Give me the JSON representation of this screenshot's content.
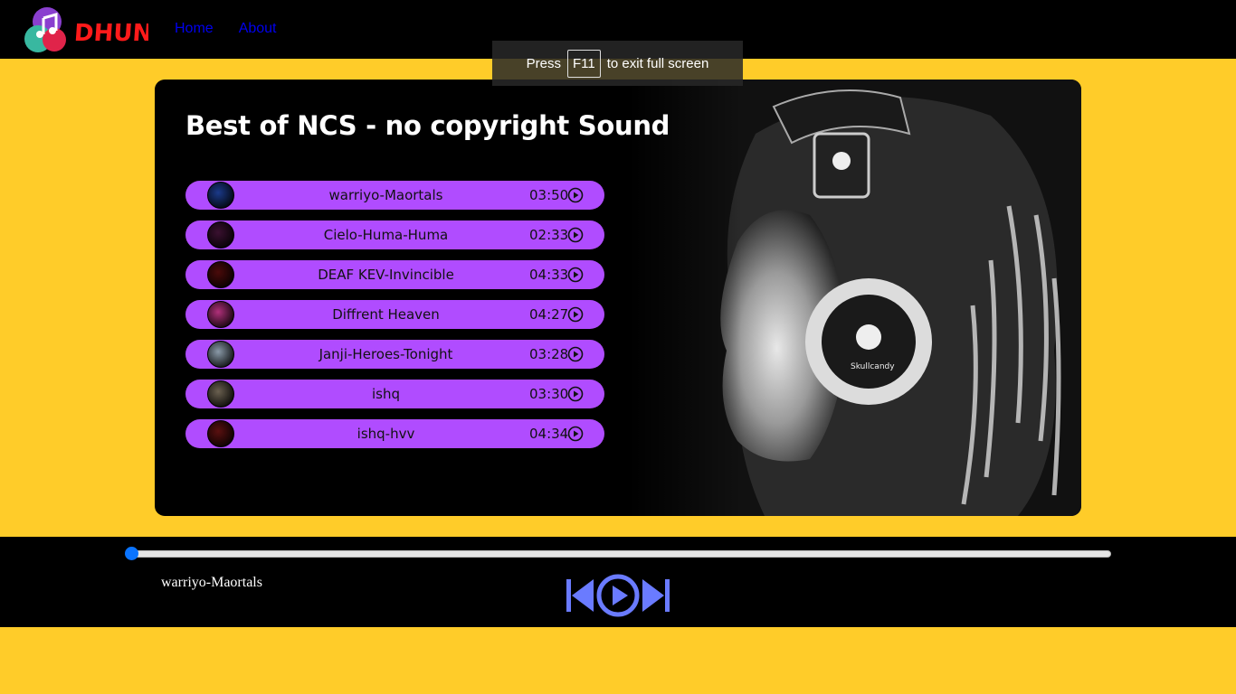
{
  "nav": {
    "brand": "DHUN",
    "links": [
      "Home",
      "About"
    ]
  },
  "toast": {
    "prefix": "Press",
    "key": "F11",
    "suffix": "to exit full screen"
  },
  "playlist": {
    "title": "Best of NCS - no copyright Sound",
    "songs": [
      {
        "name": "warriyo-Maortals",
        "duration": "03:50",
        "thumb_color": "#1b3a8a"
      },
      {
        "name": "Cielo-Huma-Huma",
        "duration": "02:33",
        "thumb_color": "#3a1030"
      },
      {
        "name": "DEAF KEV-Invincible",
        "duration": "04:33",
        "thumb_color": "#4a0a0a"
      },
      {
        "name": "Diffrent Heaven",
        "duration": "04:27",
        "thumb_color": "#b0307a"
      },
      {
        "name": "Janji-Heroes-Tonight",
        "duration": "03:28",
        "thumb_color": "#8a9aa8"
      },
      {
        "name": "ishq",
        "duration": "03:30",
        "thumb_color": "#6a6050"
      },
      {
        "name": "ishq-hvv",
        "duration": "04:34",
        "thumb_color": "#5a1010"
      }
    ]
  },
  "player": {
    "now_playing": "warriyo-Maortals",
    "progress": 0,
    "accent_color": "#6a7bff"
  },
  "colors": {
    "background": "#ffcc29",
    "song_bg": "#b04cff",
    "bar": "#000000"
  }
}
